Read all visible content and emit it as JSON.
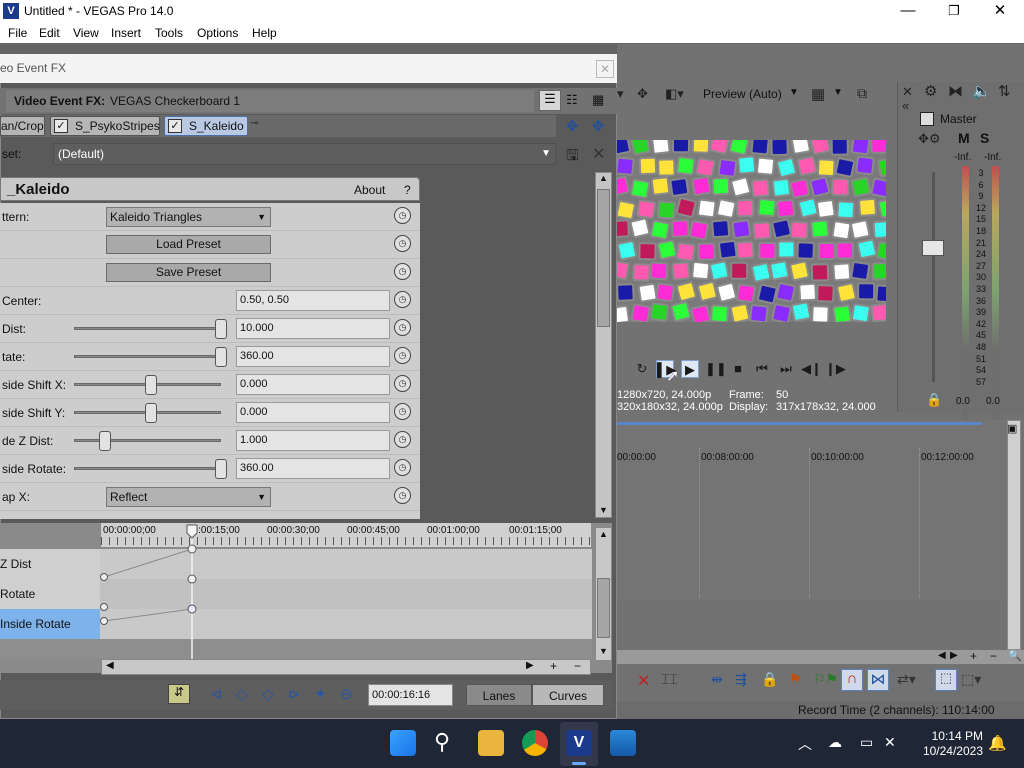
{
  "window": {
    "title": "Untitled * - VEGAS Pro 14.0",
    "minimize": "—",
    "maximize": "❐",
    "close": "✕"
  },
  "menu": [
    "File",
    "Edit",
    "View",
    "Insert",
    "Tools",
    "Options",
    "Help"
  ],
  "preview": {
    "mode": "Preview (Auto)",
    "project_label": "1280x720, 24.000p",
    "preview_label": "320x180x32, 24.000p",
    "frame_label": "Frame:",
    "frame_value": "50",
    "display_label": "Display:",
    "display_value": "317x178x32, 24.000"
  },
  "master": {
    "title": "Master",
    "m": "M",
    "s": "S",
    "inf_left": "-Inf.",
    "inf_right": "-Inf.",
    "scale": [
      "3",
      "6",
      "9",
      "12",
      "15",
      "18",
      "21",
      "24",
      "27",
      "30",
      "33",
      "36",
      "39",
      "42",
      "45",
      "48",
      "51",
      "54",
      "57"
    ],
    "level_left": "0.0",
    "level_right": "0.0"
  },
  "timeline": {
    "ruler": [
      "00:00:00",
      "00:08:00:00",
      "00:10:00:00",
      "00:12:00:00"
    ]
  },
  "status": {
    "record_time": "Record Time (2 channels): 110:14:00"
  },
  "fx": {
    "window_title": "eo Event FX",
    "header_label": "Video Event FX:",
    "header_value": "VEGAS Checkerboard 1",
    "chain": [
      "an/Crop",
      "S_PsykoStripes",
      "S_Kaleido"
    ],
    "preset_label": "set:",
    "preset_value": "(Default)",
    "plugin_name": "_Kaleido",
    "about": "About",
    "help": "?",
    "params": [
      {
        "label": "ttern:",
        "type": "dropdown",
        "value": "Kaleido Triangles"
      },
      {
        "label": "",
        "type": "button",
        "value": "Load Preset"
      },
      {
        "label": "",
        "type": "button",
        "value": "Save Preset"
      },
      {
        "label": "Center:",
        "type": "value",
        "value": "0.50, 0.50"
      },
      {
        "label": "Dist:",
        "type": "slider",
        "value": "10.000",
        "pos": 1.0
      },
      {
        "label": "tate:",
        "type": "slider",
        "value": "360.00",
        "pos": 1.0
      },
      {
        "label": "side Shift X:",
        "type": "slider",
        "value": "0.000",
        "pos": 0.5
      },
      {
        "label": "side Shift Y:",
        "type": "slider",
        "value": "0.000",
        "pos": 0.5
      },
      {
        "label": "de Z Dist:",
        "type": "slider",
        "value": "1.000",
        "pos": 0.18
      },
      {
        "label": "side Rotate:",
        "type": "slider",
        "value": "360.00",
        "pos": 1.0
      },
      {
        "label": "ap X:",
        "type": "dropdown",
        "value": "Reflect"
      }
    ],
    "keyframe_ruler": [
      "00:00:00;00",
      "00:00:15;00",
      "00:00:30;00",
      "00:00:45;00",
      "00:01:00;00",
      "00:01:15;00"
    ],
    "lanes": [
      "Z Dist",
      "Rotate",
      "Inside Rotate"
    ],
    "cursor_time": "00:00:16:16",
    "lanes_tab": "Lanes",
    "curves_tab": "Curves"
  },
  "taskbar": {
    "time": "10:14 PM",
    "date": "10/24/2023"
  }
}
